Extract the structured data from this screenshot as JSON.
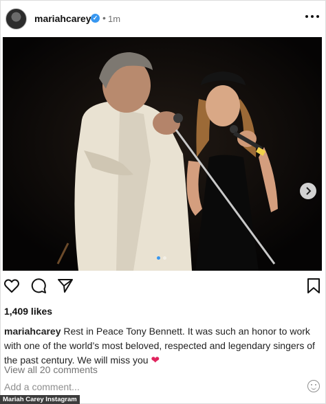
{
  "post": {
    "username": "mariahcarey",
    "verified_mark": "✓",
    "separator": "•",
    "time": "1m",
    "more_icon": "more-dots-icon",
    "likes": "1,409 likes",
    "caption_user": "mariahcarey",
    "caption_text": " Rest in Peace Tony Bennett. It was such an honor to work with one of the world’s most beloved, respected and legendary singers of the past century. We will miss you ",
    "caption_emoji": "❤",
    "view_comments": "View all 20 comments",
    "add_comment_placeholder": "Add a comment...",
    "carousel": {
      "total": 2,
      "current": 1
    },
    "accent_color": "#3897f0",
    "heart_color": "#e0245e"
  },
  "actions": [
    "heart-icon",
    "comment-icon",
    "share-icon",
    "bookmark-icon"
  ],
  "credit": "Mariah Carey Instagram"
}
